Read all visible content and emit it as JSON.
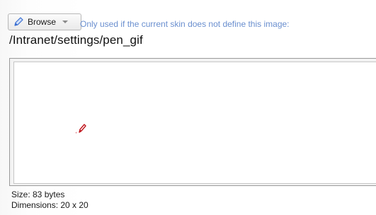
{
  "toolbar": {
    "browse_label": "Browse",
    "browse_icon": "pen-icon",
    "dropdown_icon": "chevron-down-icon",
    "hint": "Only used if the current skin does not define this image:"
  },
  "image": {
    "path": "/Intranet/settings/pen_gif",
    "preview_icon": "pen-icon",
    "size": "Size: 83 bytes",
    "dimensions": "Dimensions: 20 x 20"
  },
  "colors": {
    "hint_text": "#6a8fcf",
    "pen_red": "#c0141b",
    "browse_icon_blue": "#3b6fd1"
  }
}
